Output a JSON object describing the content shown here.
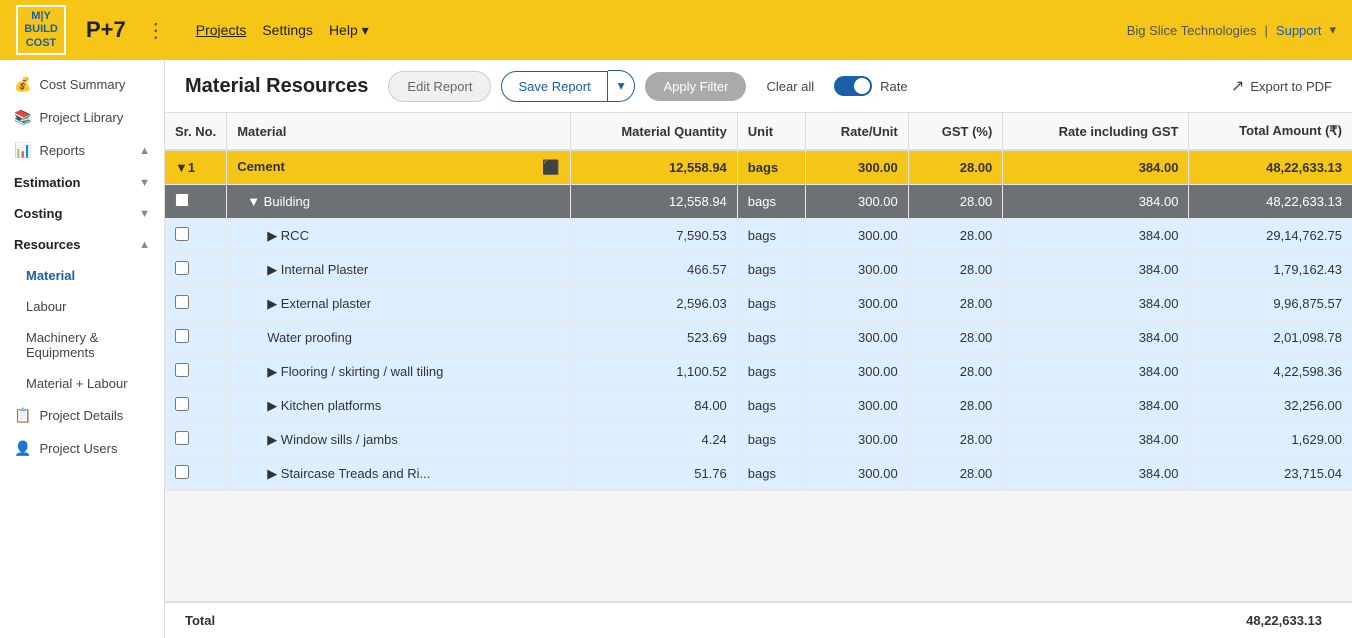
{
  "app": {
    "logo_lines": [
      "M|Y",
      "BUILD",
      "COST"
    ],
    "project_id": "P+7",
    "nav_links": [
      "Projects",
      "Settings",
      "Help"
    ],
    "company": "Big Slice Technologies",
    "support": "Support"
  },
  "sidebar": {
    "items": [
      {
        "id": "cost-summary",
        "label": "Cost Summary",
        "icon": "💰",
        "indent": false
      },
      {
        "id": "project-library",
        "label": "Project Library",
        "icon": "📚",
        "indent": false
      },
      {
        "id": "reports",
        "label": "Reports",
        "icon": "📊",
        "indent": false,
        "arrow": "▲"
      },
      {
        "id": "estimation",
        "label": "Estimation",
        "icon": "",
        "indent": false,
        "arrow": "▼",
        "section": true
      },
      {
        "id": "costing",
        "label": "Costing",
        "icon": "",
        "indent": false,
        "arrow": "▼",
        "section": true
      },
      {
        "id": "resources",
        "label": "Resources",
        "icon": "",
        "indent": false,
        "arrow": "▲",
        "section": true
      },
      {
        "id": "material",
        "label": "Material",
        "icon": "",
        "indent": true,
        "active": true
      },
      {
        "id": "labour",
        "label": "Labour",
        "icon": "",
        "indent": true
      },
      {
        "id": "machinery",
        "label": "Machinery & Equipments",
        "icon": "",
        "indent": true
      },
      {
        "id": "material-labour",
        "label": "Material + Labour",
        "icon": "",
        "indent": true
      },
      {
        "id": "project-details",
        "label": "Project Details",
        "icon": "📋",
        "indent": false
      },
      {
        "id": "project-users",
        "label": "Project Users",
        "icon": "👤",
        "indent": false
      }
    ]
  },
  "toolbar": {
    "title": "Material Resources",
    "edit_report": "Edit Report",
    "save_report": "Save Report",
    "apply_filter": "Apply Filter",
    "clear_all": "Clear all",
    "rate_label": "Rate",
    "export_label": "Export to PDF"
  },
  "table": {
    "columns": [
      "Sr. No.",
      "Material",
      "Material Quantity",
      "Unit",
      "Rate/Unit",
      "GST (%)",
      "Rate including GST",
      "Total Amount (₹)"
    ],
    "rows": [
      {
        "type": "cement-header",
        "sr": "▼1",
        "material": "Cement",
        "qty": "12,558.94",
        "unit": "bags",
        "rate": "300.00",
        "gst": "28.00",
        "rate_gst": "384.00",
        "total": "48,22,633.13"
      },
      {
        "type": "building",
        "sr": "",
        "material": "▼ Building",
        "qty": "12,558.94",
        "unit": "bags",
        "rate": "300.00",
        "gst": "28.00",
        "rate_gst": "384.00",
        "total": "48,22,633.13"
      },
      {
        "type": "sub",
        "sr": "",
        "material": "▶ RCC",
        "qty": "7,590.53",
        "unit": "bags",
        "rate": "300.00",
        "gst": "28.00",
        "rate_gst": "384.00",
        "total": "29,14,762.75"
      },
      {
        "type": "sub",
        "sr": "",
        "material": "▶ Internal Plaster",
        "qty": "466.57",
        "unit": "bags",
        "rate": "300.00",
        "gst": "28.00",
        "rate_gst": "384.00",
        "total": "1,79,162.43"
      },
      {
        "type": "sub",
        "sr": "",
        "material": "▶ External plaster",
        "qty": "2,596.03",
        "unit": "bags",
        "rate": "300.00",
        "gst": "28.00",
        "rate_gst": "384.00",
        "total": "9,96,875.57"
      },
      {
        "type": "sub",
        "sr": "",
        "material": "Water proofing",
        "qty": "523.69",
        "unit": "bags",
        "rate": "300.00",
        "gst": "28.00",
        "rate_gst": "384.00",
        "total": "2,01,098.78"
      },
      {
        "type": "sub",
        "sr": "",
        "material": "▶ Flooring / skirting / wall tiling",
        "qty": "1,100.52",
        "unit": "bags",
        "rate": "300.00",
        "gst": "28.00",
        "rate_gst": "384.00",
        "total": "4,22,598.36"
      },
      {
        "type": "sub",
        "sr": "",
        "material": "▶ Kitchen platforms",
        "qty": "84.00",
        "unit": "bags",
        "rate": "300.00",
        "gst": "28.00",
        "rate_gst": "384.00",
        "total": "32,256.00"
      },
      {
        "type": "sub",
        "sr": "",
        "material": "▶ Window sills / jambs",
        "qty": "4.24",
        "unit": "bags",
        "rate": "300.00",
        "gst": "28.00",
        "rate_gst": "384.00",
        "total": "1,629.00"
      },
      {
        "type": "sub",
        "sr": "",
        "material": "▶ Staircase Treads and Ri...",
        "qty": "51.76",
        "unit": "bags",
        "rate": "300.00",
        "gst": "28.00",
        "rate_gst": "384.00",
        "total": "23,715.04"
      }
    ],
    "footer": {
      "label": "Total",
      "total": "48,22,633.13"
    }
  }
}
